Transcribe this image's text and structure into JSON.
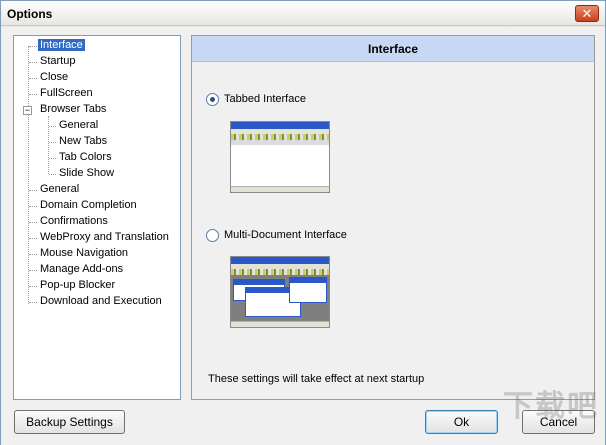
{
  "window": {
    "title": "Options",
    "close_glyph": "✕"
  },
  "tree": {
    "items": [
      {
        "label": "Interface"
      },
      {
        "label": "Startup"
      },
      {
        "label": "Close"
      },
      {
        "label": "FullScreen"
      },
      {
        "label": "Browser Tabs",
        "expanded": true,
        "children": [
          {
            "label": "General"
          },
          {
            "label": "New Tabs"
          },
          {
            "label": "Tab Colors"
          },
          {
            "label": "Slide Show"
          }
        ]
      },
      {
        "label": "General"
      },
      {
        "label": "Domain Completion"
      },
      {
        "label": "Confirmations"
      },
      {
        "label": "WebProxy and Translation"
      },
      {
        "label": "Mouse Navigation"
      },
      {
        "label": "Manage Add-ons"
      },
      {
        "label": "Pop-up Blocker"
      },
      {
        "label": "Download and Execution"
      }
    ],
    "selected": "Interface",
    "expander_glyph": "−"
  },
  "panel": {
    "header": "Interface",
    "options": [
      {
        "label": "Tabbed Interface",
        "checked": true
      },
      {
        "label": "Multi-Document Interface",
        "checked": false
      }
    ],
    "note": "These settings will take effect at next startup"
  },
  "buttons": {
    "backup": "Backup Settings",
    "ok": "Ok",
    "cancel": "Cancel"
  },
  "watermark": "下载吧",
  "colors": {
    "selection": "#316ac5",
    "header_bg": "#c8d8f4",
    "titlebar_close": "#c9411f"
  }
}
